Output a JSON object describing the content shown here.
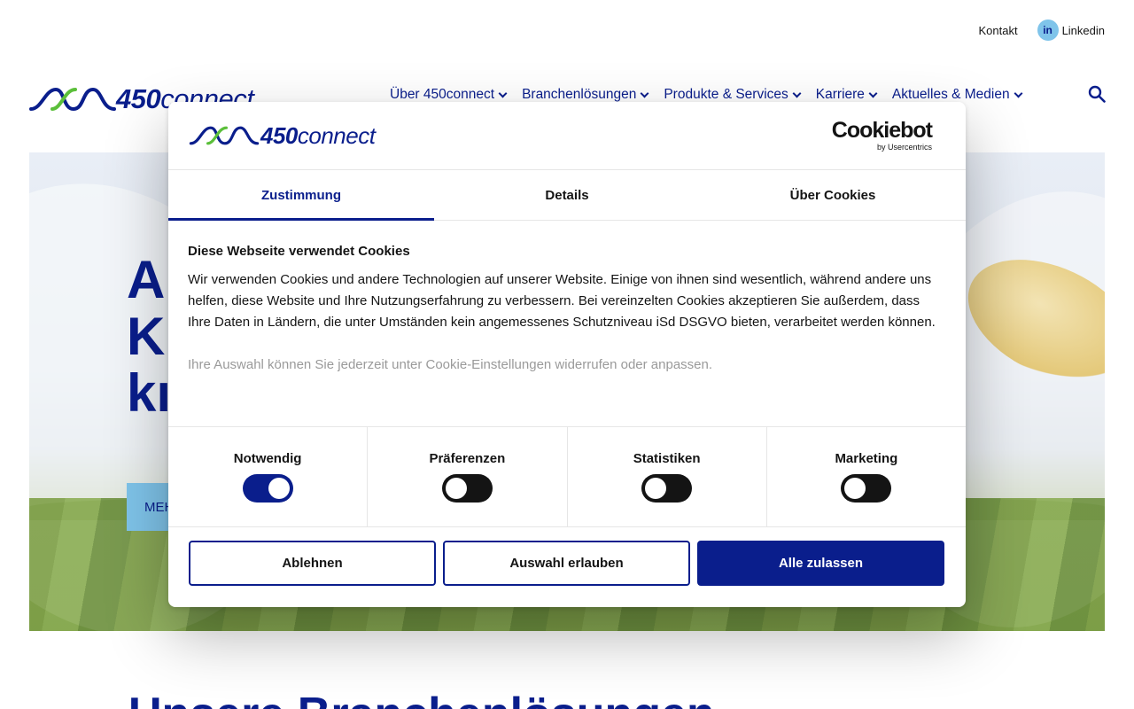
{
  "topbar": {
    "contact_label": "Kontakt",
    "linkedin_badge": "in",
    "linkedin_label": "Linkedin"
  },
  "brand": {
    "logo_number": "450",
    "logo_word": "connect",
    "primary_color": "#0a1e8c",
    "accent_color": "#7fc4ea",
    "logo_green": "#5bbf3a"
  },
  "nav": {
    "items": [
      {
        "label": "Über 450connect"
      },
      {
        "label": "Branchenlösungen"
      },
      {
        "label": "Produkte & Services"
      },
      {
        "label": "Karriere"
      },
      {
        "label": "Aktuelles & Medien"
      }
    ],
    "search_icon": "search-icon"
  },
  "hero": {
    "heading_line1": "A",
    "heading_line2": "K",
    "heading_line3": "kı",
    "button_label": "MEH"
  },
  "section": {
    "title": "Unsere Branchenlösungen"
  },
  "cookie_dialog": {
    "provider_title": "Cookiebot",
    "provider_subtitle": "by Usercentrics",
    "tabs": [
      {
        "label": "Zustimmung",
        "active": true
      },
      {
        "label": "Details",
        "active": false
      },
      {
        "label": "Über Cookies",
        "active": false
      }
    ],
    "heading": "Diese Webseite verwendet Cookies",
    "paragraph": "Wir verwenden Cookies und andere Technologien auf unserer Website. Einige von ihnen sind wesentlich, während an­dere uns helfen, diese Website und Ihre Nutzungserfahrung zu verbessern. Bei vereinzelten Cookies akzeptieren Sie außerdem, dass Ihre Daten in Ländern, die unter Umständen kein angemessenes Schutzniveau iSd DSGVO bieten, verarbeitet werden können.",
    "paragraph_faded": "Ihre Auswahl können Sie jederzeit unter Cookie-Einstellungen widerrufen oder anpassen.",
    "toggles": [
      {
        "label": "Notwendig",
        "on": true
      },
      {
        "label": "Präferenzen",
        "on": false
      },
      {
        "label": "Statistiken",
        "on": false
      },
      {
        "label": "Marketing",
        "on": false
      }
    ],
    "buttons": {
      "decline": "Ablehnen",
      "allow_selection": "Auswahl erlauben",
      "allow_all": "Alle zulassen"
    }
  }
}
